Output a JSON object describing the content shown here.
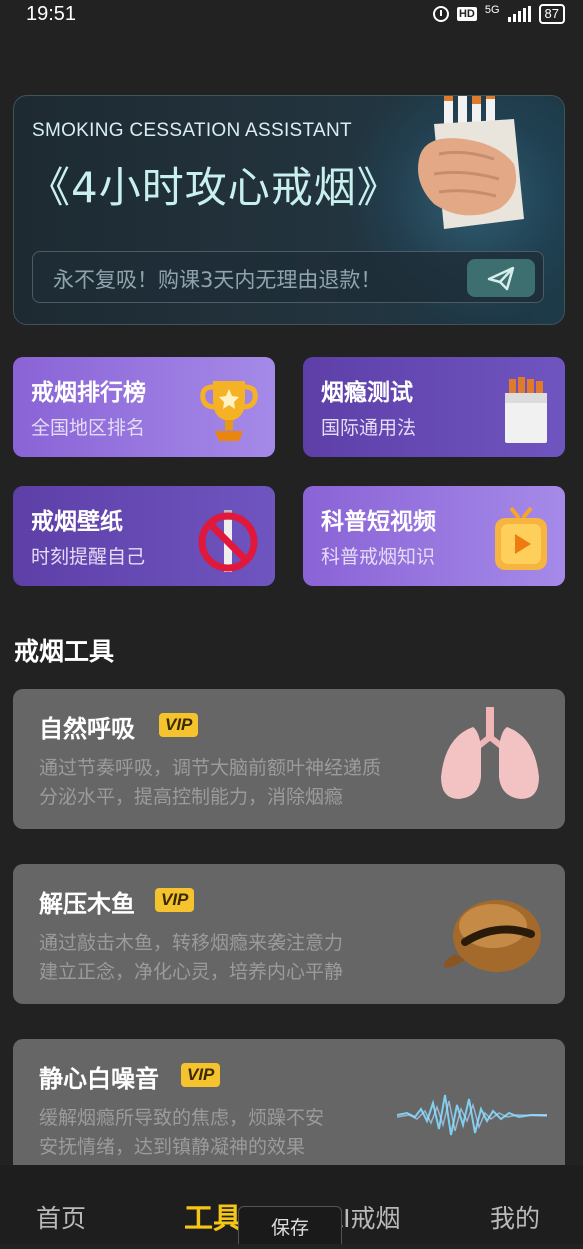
{
  "status_bar": {
    "time": "19:51",
    "hd": "HD",
    "network": "5G",
    "battery": "87"
  },
  "hero": {
    "subtitle_en": "SMOKING CESSATION ASSISTANT",
    "title": "《4小时攻心戒烟》",
    "promo_text": "永不复吸！购课3天内无理由退款！",
    "colors": {
      "title": "#c8f0ef",
      "send_button": "#3e6f70"
    }
  },
  "quick_tiles": [
    {
      "title": "戒烟排行榜",
      "subtitle": "全国地区排名",
      "icon": "trophy-icon"
    },
    {
      "title": "烟瘾测试",
      "subtitle": "国际通用法",
      "icon": "cigarette-pack-icon"
    },
    {
      "title": "戒烟壁纸",
      "subtitle": "时刻提醒自己",
      "icon": "no-smoking-icon"
    },
    {
      "title": "科普短视频",
      "subtitle": "科普戒烟知识",
      "icon": "video-tv-icon"
    }
  ],
  "tools": {
    "section_title": "戒烟工具",
    "items": [
      {
        "name": "自然呼吸",
        "badge": "VIP",
        "desc_line1": "通过节奏呼吸，调节大脑前额叶神经递质",
        "desc_line2": "分泌水平，提高控制能力，消除烟瘾",
        "icon": "lungs-icon"
      },
      {
        "name": "解压木鱼",
        "badge": "VIP",
        "desc_line1": "通过敲击木鱼，转移烟瘾来袭注意力",
        "desc_line2": "建立正念，净化心灵，培养内心平静",
        "icon": "wooden-fish-icon"
      },
      {
        "name": "静心白噪音",
        "badge": "VIP",
        "desc_line1": "缓解烟瘾所导致的焦虑，烦躁不安",
        "desc_line2": "安抚情绪，达到镇静凝神的效果",
        "icon": "sound-wave-icon"
      }
    ]
  },
  "tabbar": {
    "tabs": [
      "首页",
      "工具",
      "AI戒烟",
      "我的"
    ],
    "active": "工具",
    "save_label": "保存",
    "active_color": "#f5c518"
  }
}
